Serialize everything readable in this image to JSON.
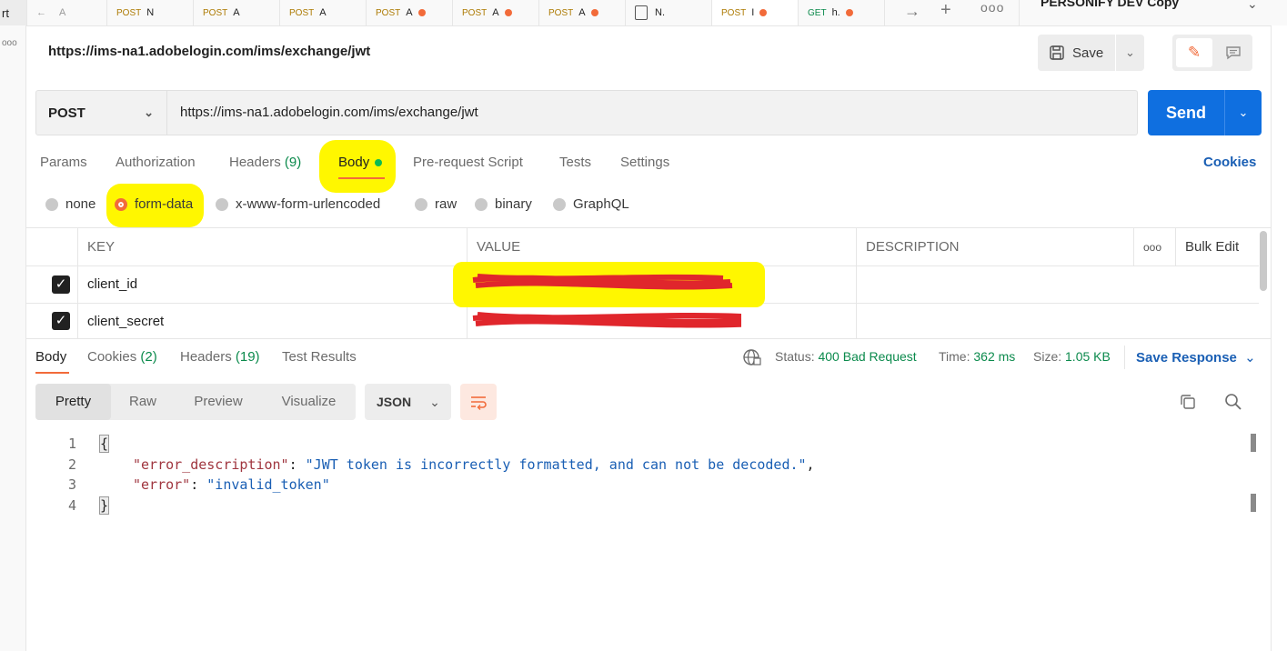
{
  "tab_bar": {
    "tabs": [
      {
        "method": "",
        "label": "A",
        "dot": false
      },
      {
        "method": "POST",
        "label": "N",
        "dot": false
      },
      {
        "method": "POST",
        "label": "A",
        "dot": false
      },
      {
        "method": "POST",
        "label": "A",
        "dot": false
      },
      {
        "method": "POST",
        "label": "A",
        "dot": true
      },
      {
        "method": "POST",
        "label": "A",
        "dot": true
      },
      {
        "method": "POST",
        "label": "A",
        "dot": true
      },
      {
        "method": "",
        "label": "N.",
        "dot": false
      },
      {
        "method": "POST",
        "label": "I",
        "dot": true
      },
      {
        "method": "GET",
        "label": "h.",
        "dot": true
      }
    ],
    "environment": "PERSONIFY DEV Copy",
    "left_fragment": "rt"
  },
  "request": {
    "title": "https://ims-na1.adobelogin.com/ims/exchange/jwt",
    "method": "POST",
    "url": "https://ims-na1.adobelogin.com/ims/exchange/jwt",
    "save_label": "Save",
    "send_label": "Send"
  },
  "request_tabs": {
    "params": "Params",
    "authorization": "Authorization",
    "headers": "Headers",
    "headers_count": "(9)",
    "body": "Body",
    "pre_request": "Pre-request Script",
    "tests": "Tests",
    "settings": "Settings",
    "cookies": "Cookies"
  },
  "body_types": {
    "none": "none",
    "form_data": "form-data",
    "urlencoded": "x-www-form-urlencoded",
    "raw": "raw",
    "binary": "binary",
    "graphql": "GraphQL",
    "selected": "form-data"
  },
  "params_table": {
    "headers": {
      "key": "KEY",
      "value": "VALUE",
      "description": "DESCRIPTION",
      "bulk_edit": "Bulk Edit"
    },
    "rows": [
      {
        "checked": true,
        "key": "client_id"
      },
      {
        "checked": true,
        "key": "client_secret"
      }
    ]
  },
  "response_tabs": {
    "body": "Body",
    "cookies": "Cookies",
    "cookies_count": "(2)",
    "headers": "Headers",
    "headers_count": "(19)",
    "test_results": "Test Results"
  },
  "status": {
    "status_label": "Status:",
    "status_value": "400 Bad Request",
    "time_label": "Time:",
    "time_value": "362 ms",
    "size_label": "Size:",
    "size_value": "1.05 KB",
    "save_response": "Save Response"
  },
  "view": {
    "pretty": "Pretty",
    "raw": "Raw",
    "preview": "Preview",
    "visualize": "Visualize",
    "format": "JSON"
  },
  "response_body": {
    "line_numbers": [
      "1",
      "2",
      "3",
      "4"
    ],
    "open_brace": "{",
    "close_brace": "}",
    "key1": "\"error_description\"",
    "val1": "\"JWT token is incorrectly formatted, and can not be decoded.\"",
    "key2": "\"error\"",
    "val2": "\"invalid_token\""
  },
  "colors": {
    "accent": "#f26b3a",
    "send": "#0f6fe0",
    "highlight": "#fff700",
    "redaction": "#e0262c",
    "status_ok_text": "#0b8a4c"
  }
}
